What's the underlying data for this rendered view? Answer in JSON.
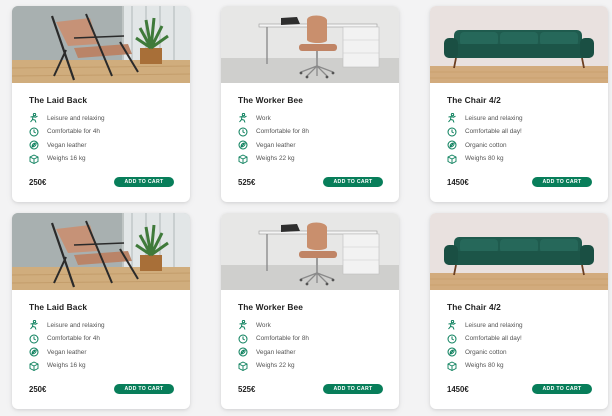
{
  "colors": {
    "accent": "#087e5a",
    "background": "#f3f3f4",
    "card": "#ffffff"
  },
  "cards": [
    {
      "name": "The Laid Back",
      "photo": "lounge-chair-with-plant-photo",
      "features": [
        {
          "icon": "people-activity-icon",
          "text": "Leisure and relaxing"
        },
        {
          "icon": "clock-icon",
          "text": "Comfortable for 4h"
        },
        {
          "icon": "leaf-icon",
          "text": "Vegan leather"
        },
        {
          "icon": "box-icon",
          "text": "Weighs 16 kg"
        }
      ],
      "price": "250€",
      "button": "ADD TO CART"
    },
    {
      "name": "The Worker Bee",
      "photo": "office-chair-at-desk-photo",
      "features": [
        {
          "icon": "people-activity-icon",
          "text": "Work"
        },
        {
          "icon": "clock-icon",
          "text": "Comfortable for 8h"
        },
        {
          "icon": "leaf-icon",
          "text": "Vegan leather"
        },
        {
          "icon": "box-icon",
          "text": "Weighs 22 kg"
        }
      ],
      "price": "525€",
      "button": "ADD TO CART"
    },
    {
      "name": "The Chair 4/2",
      "photo": "green-velvet-sofa-photo",
      "features": [
        {
          "icon": "people-activity-icon",
          "text": "Leisure and relaxing"
        },
        {
          "icon": "clock-icon",
          "text": "Comfortable all day!"
        },
        {
          "icon": "leaf-icon",
          "text": "Organic cotton"
        },
        {
          "icon": "box-icon",
          "text": "Weighs 80 kg"
        }
      ],
      "price": "1450€",
      "button": "ADD TO CART"
    },
    {
      "name": "The Laid Back",
      "photo": "lounge-chair-with-plant-photo",
      "features": [
        {
          "icon": "people-activity-icon",
          "text": "Leisure and relaxing"
        },
        {
          "icon": "clock-icon",
          "text": "Comfortable for 4h"
        },
        {
          "icon": "leaf-icon",
          "text": "Vegan leather"
        },
        {
          "icon": "box-icon",
          "text": "Weighs 16 kg"
        }
      ],
      "price": "250€",
      "button": "ADD TO CART"
    },
    {
      "name": "The Worker Bee",
      "photo": "office-chair-at-desk-photo",
      "features": [
        {
          "icon": "people-activity-icon",
          "text": "Work"
        },
        {
          "icon": "clock-icon",
          "text": "Comfortable for 8h"
        },
        {
          "icon": "leaf-icon",
          "text": "Vegan leather"
        },
        {
          "icon": "box-icon",
          "text": "Weighs 22 kg"
        }
      ],
      "price": "525€",
      "button": "ADD TO CART"
    },
    {
      "name": "The Chair 4/2",
      "photo": "green-velvet-sofa-photo",
      "features": [
        {
          "icon": "people-activity-icon",
          "text": "Leisure and relaxing"
        },
        {
          "icon": "clock-icon",
          "text": "Comfortable all day!"
        },
        {
          "icon": "leaf-icon",
          "text": "Organic cotton"
        },
        {
          "icon": "box-icon",
          "text": "Weighs 80 kg"
        }
      ],
      "price": "1450€",
      "button": "ADD TO CART"
    }
  ]
}
